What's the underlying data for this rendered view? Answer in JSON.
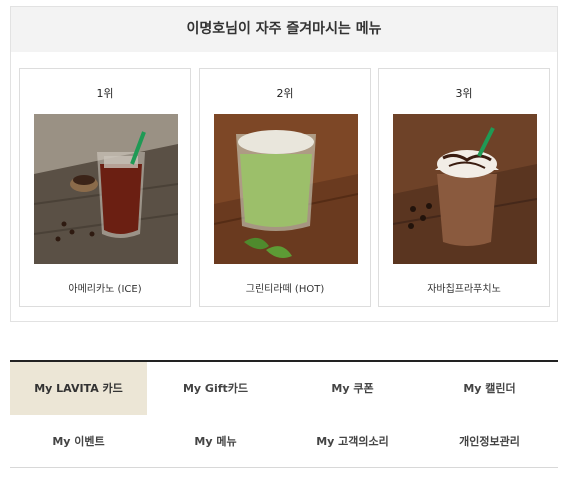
{
  "favorites": {
    "title": "이명호님이 자주 즐겨마시는 메뉴",
    "items": [
      {
        "rank": "1위",
        "name": "아메리카노 (ICE)"
      },
      {
        "rank": "2위",
        "name": "그린티라떼 (HOT)"
      },
      {
        "rank": "3위",
        "name": "자바칩프라푸치노"
      }
    ]
  },
  "my_menu": {
    "items": [
      {
        "label": "My LAVITA 카드",
        "active": true
      },
      {
        "label": "My Gift카드"
      },
      {
        "label": "My 쿠폰"
      },
      {
        "label": "My 캘린더"
      },
      {
        "label": "My 이벤트"
      },
      {
        "label": "My 메뉴"
      },
      {
        "label": "My 고객의소리"
      },
      {
        "label": "개인정보관리"
      }
    ]
  },
  "colors": {
    "active_tab_bg": "#ece6d6",
    "header_bg": "#f3f3f3",
    "straw_green": "#1f9a55"
  }
}
